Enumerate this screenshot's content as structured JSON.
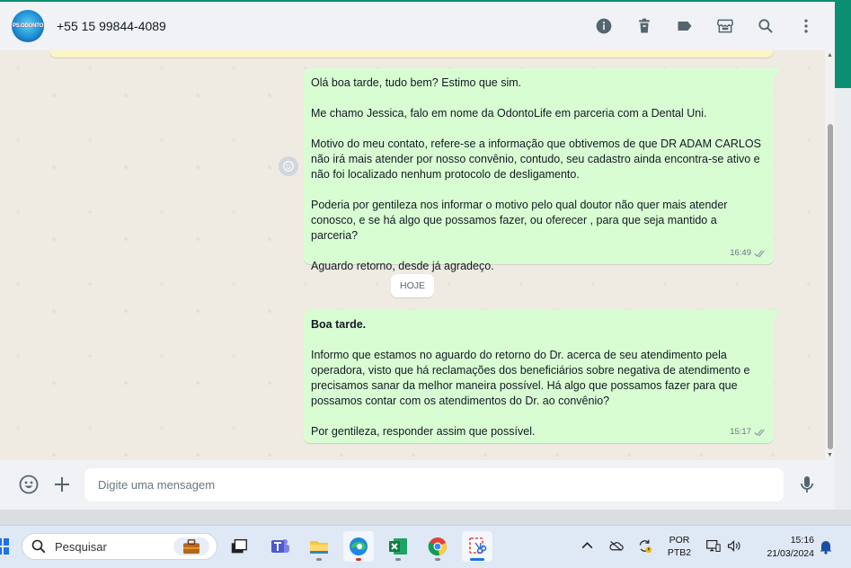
{
  "header": {
    "avatar_text": "PS.ODONTO",
    "contact_name": "+55 15 99844-4089"
  },
  "chat": {
    "message1": {
      "lines": [
        "Olá boa tarde, tudo bem? Estimo que sim.",
        "Me chamo Jessica, falo em nome da OdontoLife em parceria com a Dental Uni.",
        "Motivo do meu contato, refere-se a informação que obtivemos de que DR ADAM CARLOS não irá mais atender por nosso convênio, contudo, seu cadastro ainda encontra-se ativo e não foi localizado nenhum protocolo de desligamento.",
        "Poderia por gentileza nos informar o motivo pelo qual doutor não quer mais atender conosco, e se há algo que possamos fazer, ou oferecer , para que seja mantido a parceria?",
        "Aguardo retorno, desde já agradeço."
      ],
      "time": "16:49"
    },
    "date_chip": "HOJE",
    "message2": {
      "greeting": "Boa tarde.",
      "body": "Informo que estamos no aguardo do retorno do Dr. acerca de seu atendimento pela operadora, visto que há reclamações dos beneficiários sobre negativa de atendimento e precisamos sanar da melhor maneira possível. Há algo que possamos fazer para que possamos contar com os atendimentos do Dr. ao convênio?",
      "closing": "Por gentileza, responder assim que possível.",
      "time": "15:17"
    }
  },
  "composer": {
    "placeholder": "Digite uma mensagem"
  },
  "taskbar": {
    "search_label": "Pesquisar",
    "language_line1": "POR",
    "language_line2": "PTB2",
    "clock_time": "15:16",
    "clock_date": "21/03/2024"
  },
  "colors": {
    "outgoing_bubble": "#d9fdd3",
    "chat_background": "#efeae2",
    "accent": "#0b8f73"
  }
}
